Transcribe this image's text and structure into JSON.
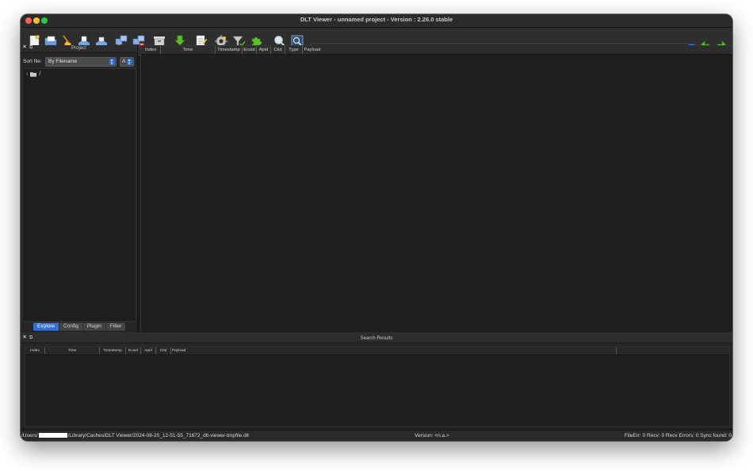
{
  "window": {
    "title": "DLT Viewer - unnamed project - Version : 2.26.0 stable"
  },
  "colors": {
    "accent": "#2f6fd6",
    "background": "#1e1e1e",
    "panel": "#262626",
    "arrow_green": "#5bbf2a"
  },
  "toolbar": {
    "icons": [
      "new-file-icon",
      "open-file-icon",
      "clear-broom-icon",
      "import-icon",
      "export-icon",
      "connect-ecu-icon",
      "disconnect-ecu-icon",
      "archive-icon",
      "download-icon",
      "settings-edit-icon",
      "plugin-icon",
      "filter-icon",
      "extension-icon",
      "search-icon",
      "find-toggle-icon"
    ]
  },
  "project": {
    "panel_title": "Project",
    "sort_label": "Sort file:",
    "sort_value": "By Filename",
    "order_value": "A",
    "tree_root": "/",
    "tabs": [
      "Explore",
      "Config",
      "Plugin",
      "Filter"
    ]
  },
  "log_table": {
    "columns": [
      "Index",
      "Time",
      "Timestamp",
      "Ecuid",
      "Apid",
      "Ctid",
      "Type",
      "Payload"
    ]
  },
  "search_results": {
    "title": "Search Results",
    "columns": [
      "Index",
      "Time",
      "Timestamp",
      "Ecuid",
      "Apid",
      "Ctid",
      "Payload"
    ]
  },
  "status": {
    "path_prefix": "/Users/",
    "path_suffix": "/Library/Caches/DLT Viewer/2024-08-20_12-51-55_71672_dlt-viewer-tmpfile.dlt",
    "version": "Version: <n.a.>",
    "counts": "FileErr: 0  Recv: 0  Recv Errors: 0  Sync found: 0"
  }
}
